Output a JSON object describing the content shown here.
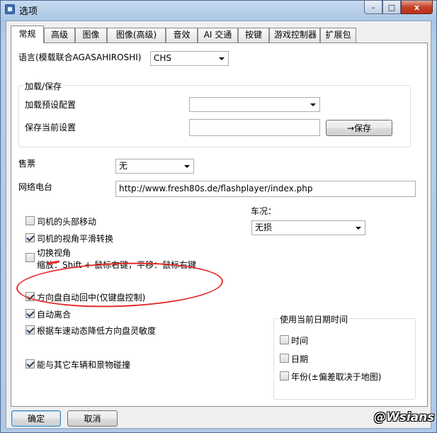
{
  "window": {
    "title": "选项",
    "close_glyph": "x",
    "min_glyph": "–",
    "max_glyph": "□"
  },
  "tabs": [
    "常规",
    "高级",
    "图像",
    "图像(高级)",
    "音效",
    "AI 交通",
    "按键",
    "游戏控制器",
    "扩展包"
  ],
  "general": {
    "language_label": "语言(模载联合AGASAHIROSHI)",
    "language_value": "CHS",
    "load_save_group": "加载/保存",
    "load_preset_label": "加载预设配置",
    "load_preset_value": "",
    "save_current_label": "保存当前设置",
    "save_current_value": "",
    "save_button": "→保存",
    "tickets_label": "售票",
    "tickets_value": "无",
    "radio_label": "网络电台",
    "radio_url": "http://www.fresh80s.de/flashplayer/index.php",
    "vehicle_condition_label": "车况：",
    "vehicle_condition_value": "无损",
    "checkboxes": [
      {
        "label": "司机的头部移动",
        "checked": false
      },
      {
        "label": "司机的视角平滑转换",
        "checked": true
      },
      {
        "label": "切换视角",
        "checked": false
      },
      {
        "label": "方向盘自动回中(仅键盘控制)",
        "checked": true
      },
      {
        "label": "自动离合",
        "checked": true
      },
      {
        "label": "根据车速动态降低方向盘灵敏度",
        "checked": true
      },
      {
        "label": "能与其它车辆和景物碰撞",
        "checked": true
      }
    ],
    "switch_view_hint": "缩放：Shift + 鼠标右键，平移：鼠标右键",
    "date_group": "使用当前日期时间",
    "date_checkboxes": [
      {
        "label": "时间",
        "checked": false
      },
      {
        "label": "日期",
        "checked": false
      },
      {
        "label": "年份(±偏差取决于地图)",
        "checked": false
      }
    ]
  },
  "footer": {
    "ok": "确定",
    "cancel": "取消"
  },
  "watermark": "@Wsians",
  "annotation_color": "#e52a2a"
}
